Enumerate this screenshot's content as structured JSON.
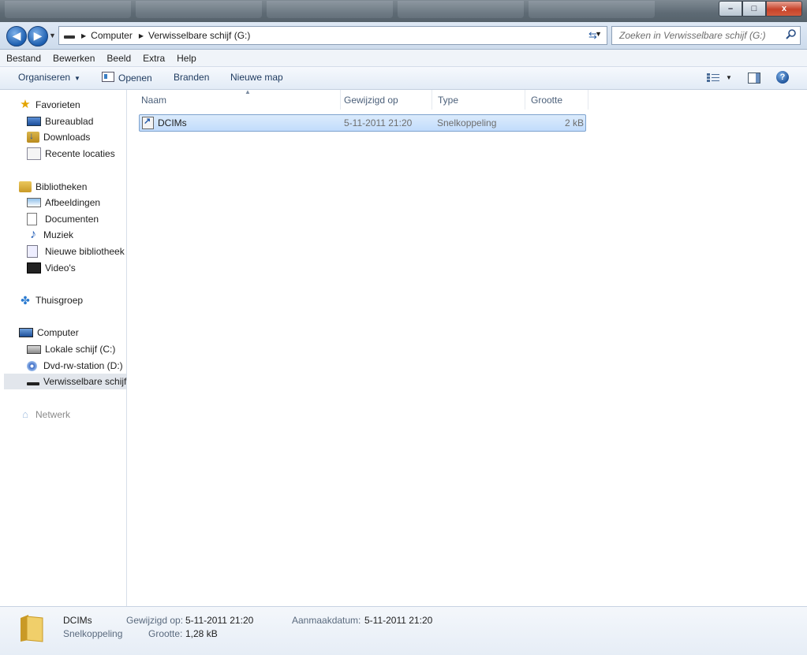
{
  "window": {
    "minimize": "–",
    "maximize": "□",
    "close": "x"
  },
  "address": {
    "crumbs": [
      "Computer",
      "Verwisselbare schijf (G:)"
    ],
    "search_placeholder": "Zoeken in Verwisselbare schijf (G:)"
  },
  "menu": [
    "Bestand",
    "Bewerken",
    "Beeld",
    "Extra",
    "Help"
  ],
  "toolbar": {
    "organize": "Organiseren",
    "open": "Openen",
    "burn": "Branden",
    "new_folder": "Nieuwe map"
  },
  "nav": {
    "favorites": "Favorieten",
    "desktop": "Bureaublad",
    "downloads": "Downloads",
    "recent": "Recente locaties",
    "libraries": "Bibliotheken",
    "pictures": "Afbeeldingen",
    "documents": "Documenten",
    "music": "Muziek",
    "new_library": "Nieuwe bibliotheek",
    "videos": "Video's",
    "homegroup": "Thuisgroep",
    "computer": "Computer",
    "local_disk": "Lokale schijf (C:)",
    "dvd": "Dvd-rw-station (D:)",
    "removable": "Verwisselbare schijf",
    "network": "Netwerk"
  },
  "columns": [
    "Naam",
    "Gewijzigd op",
    "Type",
    "Grootte"
  ],
  "files": [
    {
      "name": "DCIMs",
      "modified": "5-11-2011 21:20",
      "type": "Snelkoppeling",
      "size": "2 kB"
    }
  ],
  "details": {
    "name": "DCIMs",
    "type": "Snelkoppeling",
    "modified_label": "Gewijzigd op:",
    "modified_value": "5-11-2011 21:20",
    "size_label": "Grootte:",
    "size_value": "1,28 kB",
    "created_label": "Aanmaakdatum:",
    "created_value": "5-11-2011 21:20"
  }
}
